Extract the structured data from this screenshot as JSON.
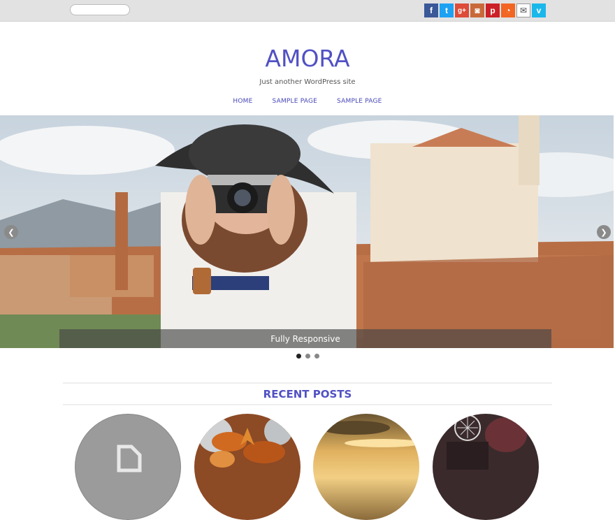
{
  "topbar": {
    "search_placeholder": "",
    "social_links": [
      {
        "name": "facebook-icon",
        "glyph": "f",
        "color": "#3b5998"
      },
      {
        "name": "twitter-icon",
        "glyph": "t",
        "color": "#1da1f2"
      },
      {
        "name": "google-plus-icon",
        "glyph": "g+",
        "color": "#dd4b39"
      },
      {
        "name": "instagram-icon",
        "glyph": "◙",
        "color": "#c9693b"
      },
      {
        "name": "pinterest-icon",
        "glyph": "p",
        "color": "#cb2027"
      },
      {
        "name": "rss-icon",
        "glyph": "◔",
        "color": "#f26522"
      },
      {
        "name": "email-icon",
        "glyph": "✉",
        "color": "#ffffff"
      },
      {
        "name": "vimeo-icon",
        "glyph": "v",
        "color": "#1ab7ea"
      }
    ]
  },
  "header": {
    "site_title": "AMORA",
    "tagline": "Just another WordPress site"
  },
  "nav": {
    "items": [
      "HOME",
      "SAMPLE PAGE",
      "SAMPLE PAGE"
    ]
  },
  "slider": {
    "caption": "Fully Responsive",
    "prev_glyph": "❮",
    "next_glyph": "❯",
    "total_slides": 3,
    "active_slide": 1
  },
  "recent_posts": {
    "title": "RECENT POSTS"
  },
  "colors": {
    "accent": "#5151c4",
    "topbar": "#e2e2e2"
  }
}
